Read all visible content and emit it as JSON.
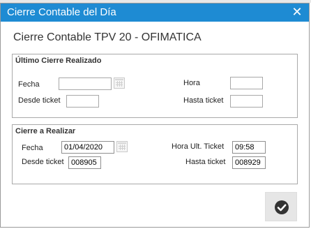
{
  "window": {
    "title": "Cierre Contable del Día"
  },
  "heading": "Cierre Contable TPV 20 - OFIMATICA",
  "ultimo_cierre": {
    "legend": "Último Cierre Realizado",
    "fecha_label": "Fecha",
    "fecha_value": "",
    "hora_label": "Hora",
    "hora_value": "",
    "desde_label": "Desde ticket",
    "desde_value": "",
    "hasta_label": "Hasta ticket",
    "hasta_value": ""
  },
  "cierre_realizar": {
    "legend": "Cierre a Realizar",
    "fecha_label": "Fecha",
    "fecha_value": "01/04/2020",
    "hora_label": "Hora Ult. Ticket",
    "hora_value": "09:58",
    "desde_label": "Desde ticket",
    "desde_value": "008905",
    "hasta_label": "Hasta ticket",
    "hasta_value": "008929"
  },
  "icons": {
    "close": "close-icon",
    "calendar": "calendar-icon",
    "confirm": "checkmark-icon"
  },
  "colors": {
    "titlebar": "#1e8bd3",
    "title_text": "#ffffff"
  }
}
